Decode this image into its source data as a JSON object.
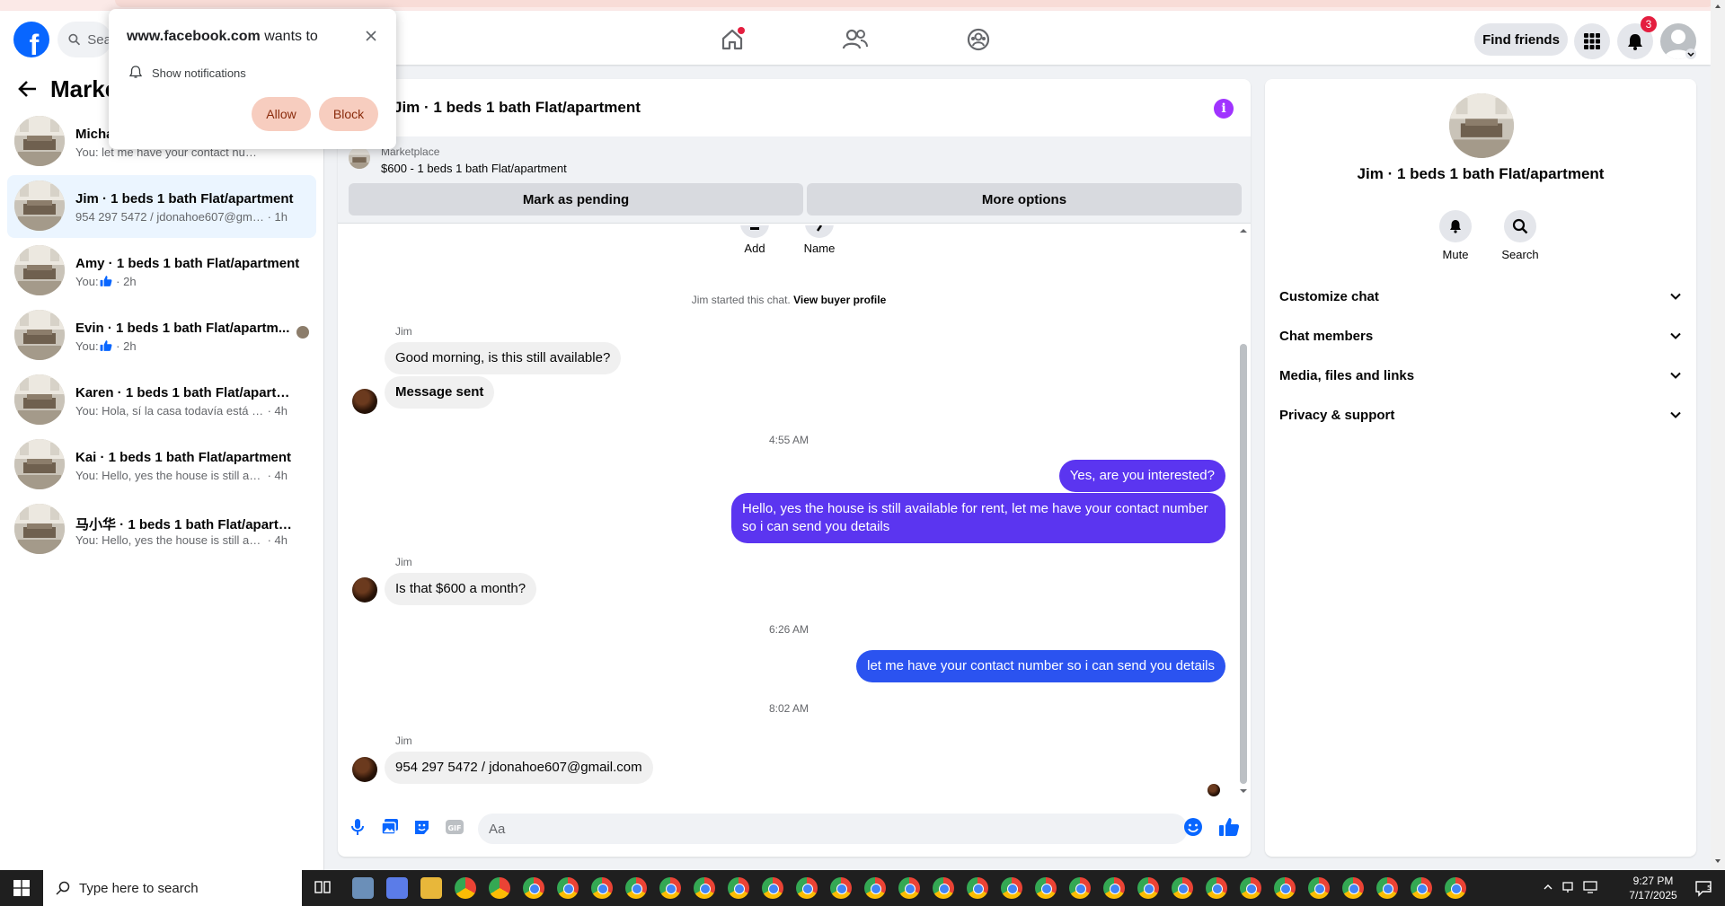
{
  "browser": {},
  "topbar": {
    "search_placeholder": "Sea",
    "find_friends": "Find friends",
    "notification_count": "3"
  },
  "popup": {
    "site": "www.facebook.com",
    "wants_to": " wants to",
    "permission": "Show notifications",
    "allow": "Allow",
    "block": "Block"
  },
  "sidebar": {
    "title": "Marke",
    "conversations": [
      {
        "name": "Micha",
        "preview": "You: let me have your contact numbe...",
        "time": ""
      },
      {
        "name": "Jim · 1 beds 1 bath Flat/apartment",
        "preview": "954 297 5472 / jdonahoe607@gmail....",
        "time": " · 1h"
      },
      {
        "name": "Amy · 1 beds 1 bath Flat/apartment",
        "preview": "You: ",
        "time": " · 2h"
      },
      {
        "name": "Evin · 1 beds 1 bath Flat/apartm...",
        "preview": "You: ",
        "time": " · 2h"
      },
      {
        "name": "Karen · 1 beds 1 bath Flat/apartment",
        "preview": "You: Hola, sí la casa todavía está dispo...",
        "time": " · 4h"
      },
      {
        "name": "Kai · 1 beds 1 bath Flat/apartment",
        "preview": "You: Hello, yes the house is still availa...",
        "time": " · 4h"
      },
      {
        "name": "马小华 · 1 beds 1 bath Flat/apartm...",
        "preview": "You: Hello, yes the house is still availa...",
        "time": " · 4h"
      }
    ]
  },
  "chat": {
    "title": "Jim · 1 beds 1 bath Flat/apartment",
    "listing_source": "Marketplace",
    "listing_price": "$600 - 1 beds 1 bath Flat/apartment",
    "mark_pending": "Mark as pending",
    "more_options": "More options",
    "action_add": "Add",
    "action_name": "Name",
    "started_text": "Jim started this chat.",
    "view_profile": "View buyer profile",
    "sender": "Jim",
    "msg1": "Good morning, is this still available?",
    "msg2": "Message sent",
    "time1": "4:55 AM",
    "out1": "Yes, are you interested?",
    "out2": "Hello, yes the house is still available for rent, let me have your contact number so i can send you details",
    "msg3": "Is that $600 a month?",
    "time2": "6:26 AM",
    "out3": "let me have your contact number so i can send you details",
    "time3": "8:02 AM",
    "msg4": "954 297 5472  / jdonahoe607@gmail.com",
    "composer_placeholder": "Aa"
  },
  "details": {
    "title": "Jim · 1 beds 1 bath Flat/apartment",
    "mute": "Mute",
    "search": "Search",
    "rows": [
      "Customize chat",
      "Chat members",
      "Media, files and links",
      "Privacy & support"
    ]
  },
  "taskbar": {
    "search_placeholder": "Type here to search",
    "time": "9:27 PM",
    "date": "7/17/2025"
  },
  "colors": {
    "fb_blue": "#0866ff",
    "outgoing_bubble": "#5b35f0",
    "outgoing_bubble_alt": "#2b53f0",
    "popup_button": "#f7cdbf",
    "notification_badge": "#e41e3f"
  }
}
